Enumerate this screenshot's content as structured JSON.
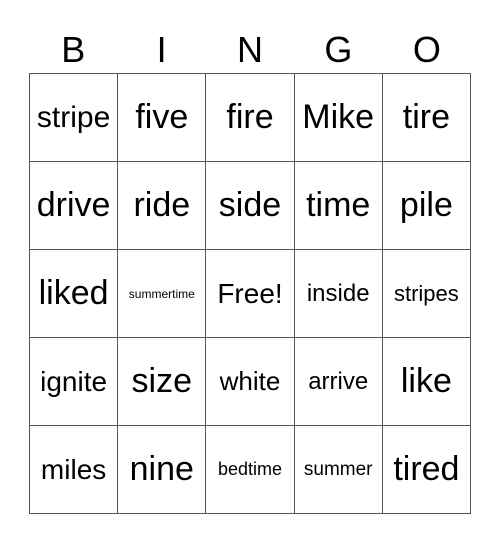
{
  "header": [
    "B",
    "I",
    "N",
    "G",
    "O"
  ],
  "cells": [
    [
      "stripe",
      "five",
      "fire",
      "Mike",
      "tire"
    ],
    [
      "drive",
      "ride",
      "side",
      "time",
      "pile"
    ],
    [
      "liked",
      "summertime",
      "Free!",
      "inside",
      "stripes"
    ],
    [
      "ignite",
      "size",
      "white",
      "arrive",
      "like"
    ],
    [
      "miles",
      "nine",
      "bedtime",
      "summer",
      "tired"
    ]
  ]
}
